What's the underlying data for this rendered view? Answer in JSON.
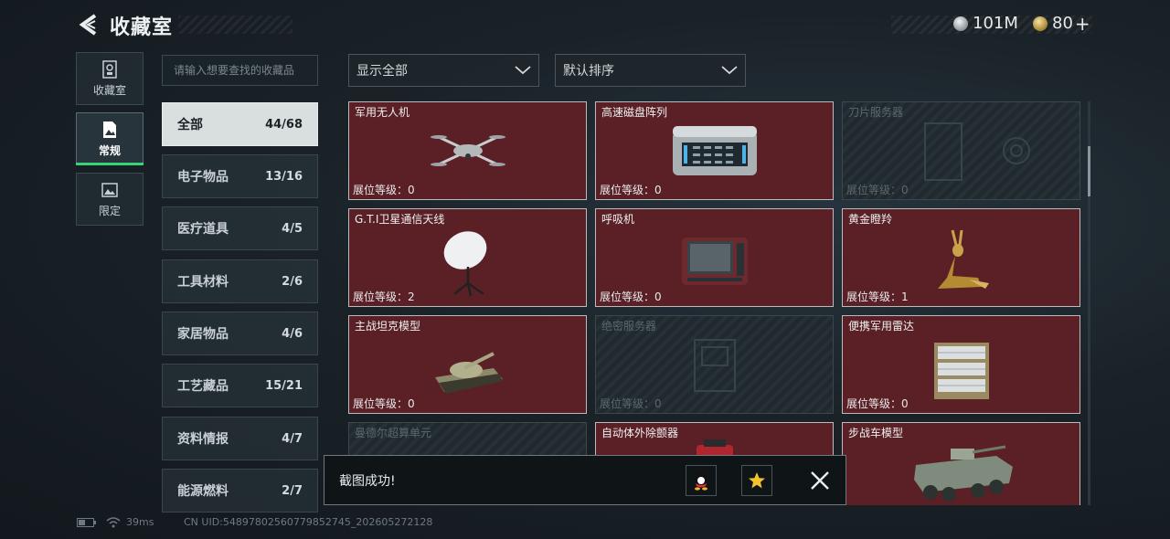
{
  "header": {
    "title": "收藏室",
    "currency": [
      {
        "icon": "silver-coin-icon",
        "value": "101M"
      },
      {
        "icon": "gold-coin-icon",
        "value": "80"
      }
    ]
  },
  "side_tabs": [
    {
      "label": "收藏室",
      "icon": "collection-icon"
    },
    {
      "label": "常规",
      "icon": "document-icon",
      "active": true
    },
    {
      "label": "限定",
      "icon": "picture-icon"
    }
  ],
  "search": {
    "placeholder": "请输入想要查找的收藏品"
  },
  "filters": {
    "display": "显示全部",
    "sort": "默认排序"
  },
  "categories": [
    {
      "label": "全部",
      "count": "44/68",
      "active": true
    },
    {
      "label": "电子物品",
      "count": "13/16"
    },
    {
      "label": "医疗道具",
      "count": "4/5"
    },
    {
      "label": "工具材料",
      "count": "2/6"
    },
    {
      "label": "家居物品",
      "count": "4/6"
    },
    {
      "label": "工艺藏品",
      "count": "15/21"
    },
    {
      "label": "资料情报",
      "count": "4/7"
    },
    {
      "label": "能源燃料",
      "count": "2/7"
    }
  ],
  "items": [
    {
      "name": "军用无人机",
      "level": "展位等级：0",
      "icon": "drone-icon"
    },
    {
      "name": "高速磁盘阵列",
      "level": "展位等级：0",
      "icon": "disk-array-icon"
    },
    {
      "name": "刀片服务器",
      "level": "展位等级：0",
      "locked": true,
      "icon": "server-icon"
    },
    {
      "name": "G.T.I卫星通信天线",
      "level": "展位等级：2",
      "icon": "satellite-dish-icon"
    },
    {
      "name": "呼吸机",
      "level": "展位等级：0",
      "icon": "ventilator-icon"
    },
    {
      "name": "黄金瞪羚",
      "level": "展位等级：1",
      "icon": "golden-gazelle-icon"
    },
    {
      "name": "主战坦克模型",
      "level": "展位等级：0",
      "icon": "tank-icon"
    },
    {
      "name": "绝密服务器",
      "level": "展位等级：0",
      "locked": true,
      "icon": "server-icon"
    },
    {
      "name": "便携军用雷达",
      "level": "展位等级：0",
      "icon": "radar-icon"
    },
    {
      "name": "曼德尔超算单元",
      "level": "",
      "locked": true,
      "icon": "supercomputer-icon"
    },
    {
      "name": "自动体外除颤器",
      "level": "",
      "icon": "defibrillator-icon"
    },
    {
      "name": "步战车模型",
      "level": "",
      "icon": "ifv-icon"
    }
  ],
  "toast": {
    "message": "截图成功!"
  },
  "status": {
    "ping": "39ms",
    "uid": "CN UID:5489780256077985274​5_202605272128"
  },
  "colors": {
    "accent_green": "#35d37a",
    "owned_card": "#5a2025"
  }
}
